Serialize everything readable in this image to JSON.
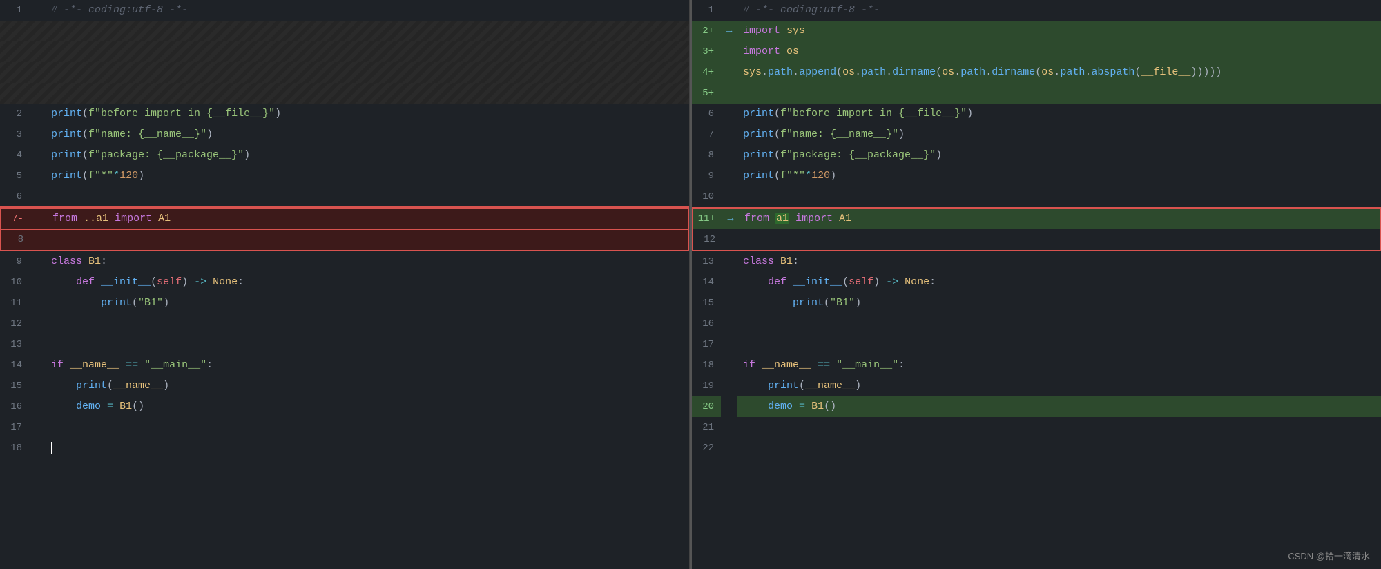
{
  "watermark": "CSDN @拾一滴清水",
  "left_pane": {
    "lines": [
      {
        "num": "1",
        "type": "normal",
        "content": "# -*- coding:utf-8 -*-",
        "tokens": [
          {
            "t": "cm",
            "v": "# -*- coding:utf-8 -*-"
          }
        ]
      },
      {
        "num": "",
        "type": "striped",
        "content": ""
      },
      {
        "num": "",
        "type": "striped",
        "content": ""
      },
      {
        "num": "",
        "type": "striped",
        "content": ""
      },
      {
        "num": "",
        "type": "striped",
        "content": ""
      },
      {
        "num": "2",
        "type": "normal",
        "content": "print(f\"before import in {__file__}\")",
        "tokens": [
          {
            "t": "fn",
            "v": "print"
          },
          {
            "t": "pu",
            "v": "("
          },
          {
            "t": "st",
            "v": "f\"before import in {__file__}\""
          },
          {
            "t": "pu",
            "v": ")"
          }
        ]
      },
      {
        "num": "3",
        "type": "normal",
        "content": "print(f\"name: {__name__}\")",
        "tokens": [
          {
            "t": "fn",
            "v": "print"
          },
          {
            "t": "pu",
            "v": "("
          },
          {
            "t": "st",
            "v": "f\"name: {__name__}\""
          },
          {
            "t": "pu",
            "v": ")"
          }
        ]
      },
      {
        "num": "4",
        "type": "normal",
        "content": "print(f\"package: {__package__}\")",
        "tokens": [
          {
            "t": "fn",
            "v": "print"
          },
          {
            "t": "pu",
            "v": "("
          },
          {
            "t": "st",
            "v": "f\"package: {__package__}\""
          },
          {
            "t": "pu",
            "v": ")"
          }
        ]
      },
      {
        "num": "5",
        "type": "normal",
        "content": "print(f\"*\"*120)",
        "tokens": [
          {
            "t": "fn",
            "v": "print"
          },
          {
            "t": "pu",
            "v": "("
          },
          {
            "t": "st",
            "v": "f\"*\""
          },
          {
            "t": "op",
            "v": "*"
          },
          {
            "t": "num",
            "v": "120"
          },
          {
            "t": "pu",
            "v": ")"
          }
        ]
      },
      {
        "num": "6",
        "type": "normal",
        "content": ""
      },
      {
        "num": "7",
        "type": "deleted",
        "content": "from ..a1 import A1",
        "redbox": true
      },
      {
        "num": "8",
        "type": "deleted-empty",
        "content": "",
        "redbox": true
      },
      {
        "num": "9",
        "type": "normal",
        "content": "class B1:"
      },
      {
        "num": "10",
        "type": "normal",
        "content": "    def __init__(self) -> None:"
      },
      {
        "num": "11",
        "type": "normal",
        "content": "        print(\"B1\")"
      },
      {
        "num": "12",
        "type": "normal",
        "content": ""
      },
      {
        "num": "13",
        "type": "normal",
        "content": ""
      },
      {
        "num": "14",
        "type": "normal",
        "content": "if __name__ == \"__main__\":"
      },
      {
        "num": "15",
        "type": "normal",
        "content": "    print(__name__)"
      },
      {
        "num": "16",
        "type": "normal",
        "content": "    demo = B1()"
      },
      {
        "num": "17",
        "type": "normal",
        "content": ""
      },
      {
        "num": "18",
        "type": "normal",
        "content": "",
        "cursor": true
      }
    ]
  },
  "right_pane": {
    "lines": [
      {
        "num": "1",
        "type": "normal",
        "content": "# -*- coding:utf-8 -*-",
        "tokens": [
          {
            "t": "cm",
            "v": "# -*- coding:utf-8 -*-"
          }
        ]
      },
      {
        "num": "2",
        "type": "added-green",
        "content": "import sys",
        "arrow": true
      },
      {
        "num": "3",
        "type": "added-green",
        "content": "import os"
      },
      {
        "num": "4",
        "type": "added-green",
        "content": "sys.path.append(os.path.dirname(os.path.dirname(os.path.abspath(__file__))))"
      },
      {
        "num": "5",
        "type": "added-green",
        "content": ""
      },
      {
        "num": "6",
        "type": "normal",
        "content": "print(f\"before import in {__file__}\")"
      },
      {
        "num": "7",
        "type": "normal",
        "content": "print(f\"name: {__name__}\")"
      },
      {
        "num": "8",
        "type": "normal",
        "content": "print(f\"package: {__package__}\")"
      },
      {
        "num": "9",
        "type": "normal",
        "content": "print(f\"*\"*120)"
      },
      {
        "num": "10",
        "type": "normal",
        "content": ""
      },
      {
        "num": "11",
        "type": "added-green",
        "content": "from a1 import A1",
        "arrow": true,
        "redbox": true
      },
      {
        "num": "12",
        "type": "normal",
        "content": "",
        "redbox": true
      },
      {
        "num": "13",
        "type": "normal",
        "content": "class B1:"
      },
      {
        "num": "14",
        "type": "normal",
        "content": "    def __init__(self) -> None:"
      },
      {
        "num": "15",
        "type": "normal",
        "content": "        print(\"B1\")"
      },
      {
        "num": "16",
        "type": "normal",
        "content": ""
      },
      {
        "num": "17",
        "type": "normal",
        "content": ""
      },
      {
        "num": "18",
        "type": "normal",
        "content": "if __name__ == \"__main__\":"
      },
      {
        "num": "19",
        "type": "normal",
        "content": "    print(__name__)"
      },
      {
        "num": "20",
        "type": "normal",
        "content": "    demo = B1()"
      },
      {
        "num": "21",
        "type": "normal",
        "content": ""
      },
      {
        "num": "22",
        "type": "normal",
        "content": ""
      }
    ]
  }
}
